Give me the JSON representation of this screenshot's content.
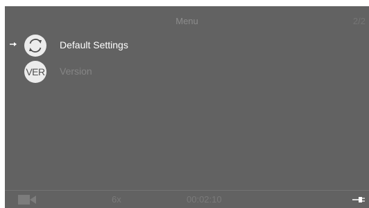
{
  "header": {
    "title": "Menu",
    "page_indicator": "2/2"
  },
  "menu": {
    "items": [
      {
        "label": "Default Settings",
        "icon": "reset-refresh-icon",
        "selected": true
      },
      {
        "label": "Version",
        "icon_text": "VER",
        "icon": "version-icon",
        "selected": false
      }
    ]
  },
  "footer": {
    "mode_icon": "video-camera-icon",
    "zoom": "6x",
    "time": "00:02:10",
    "power_icon": "power-plug-icon"
  },
  "colors": {
    "screen_background": "#626262",
    "selected_text": "#ffffff",
    "dimmed_text": "#858585",
    "icon_fill": "#ececec"
  }
}
